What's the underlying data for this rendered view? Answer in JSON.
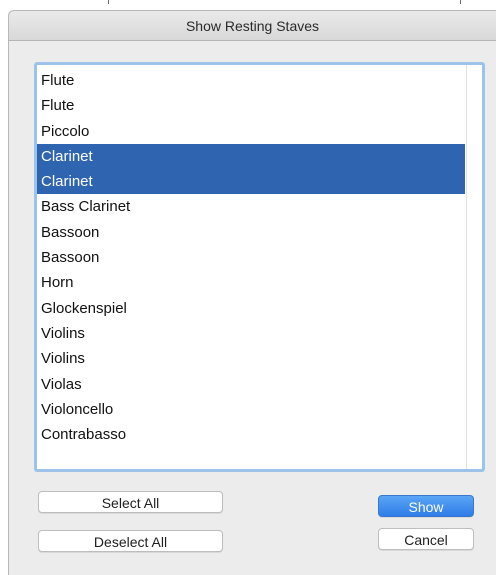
{
  "dialog": {
    "title": "Show Resting Staves"
  },
  "staves": {
    "items": [
      {
        "label": "Flute",
        "selected": false
      },
      {
        "label": "Flute",
        "selected": false
      },
      {
        "label": "Piccolo",
        "selected": false
      },
      {
        "label": "Clarinet",
        "selected": true
      },
      {
        "label": "Clarinet",
        "selected": true
      },
      {
        "label": "Bass Clarinet",
        "selected": false
      },
      {
        "label": "Bassoon",
        "selected": false
      },
      {
        "label": "Bassoon",
        "selected": false
      },
      {
        "label": "Horn",
        "selected": false
      },
      {
        "label": "Glockenspiel",
        "selected": false
      },
      {
        "label": "Violins",
        "selected": false
      },
      {
        "label": "Violins",
        "selected": false
      },
      {
        "label": "Violas",
        "selected": false
      },
      {
        "label": "Violoncello",
        "selected": false
      },
      {
        "label": "Contrabasso",
        "selected": false
      }
    ]
  },
  "buttons": {
    "select_all": "Select All",
    "deselect_all": "Deselect All",
    "show": "Show",
    "cancel": "Cancel"
  },
  "colors": {
    "selection": "#2e64b0",
    "focus_ring": "#9ec3ea",
    "primary_button": "#2e7de8"
  }
}
